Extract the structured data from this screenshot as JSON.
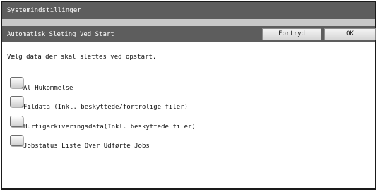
{
  "window": {
    "title": "Systemindstillinger"
  },
  "header": {
    "subtitle": "Automatisk Sleting Ved Start",
    "cancel_label": "Fortryd",
    "ok_label": "OK"
  },
  "main": {
    "instruction": "Vælg data der skal slettes ved opstart.",
    "options": [
      {
        "label": "Al Hukommelse",
        "checked": false
      },
      {
        "label": "Fildata (Inkl. beskyttede/fortrolige filer)",
        "checked": false
      },
      {
        "label": "Hurtigarkiveringsdata(Inkl. beskyttede filer)",
        "checked": false
      },
      {
        "label": "Jobstatus Liste Over Udførte Jobs",
        "checked": false
      }
    ]
  },
  "colors": {
    "title_bar": "#5d5d5d",
    "separator": "#c8c8c8",
    "background": "#ffffff"
  }
}
